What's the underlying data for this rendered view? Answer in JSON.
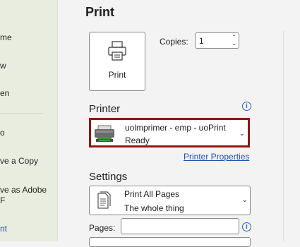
{
  "sidebar": {
    "items": [
      {
        "label": "me"
      },
      {
        "label": "w"
      },
      {
        "label": "en"
      },
      {
        "label": "o"
      },
      {
        "label": "ve a Copy"
      },
      {
        "label": "ve as Adobe"
      },
      {
        "label": "F"
      },
      {
        "label": "nt"
      }
    ]
  },
  "main": {
    "title": "Print",
    "print_button": {
      "label": "Print",
      "icon": "printer-icon"
    },
    "copies": {
      "label": "Copies:",
      "value": "1"
    },
    "printer": {
      "heading": "Printer",
      "name": "uolmprimer - emp - uoPrint",
      "status": "Ready",
      "properties_link": "Printer Properties"
    },
    "settings": {
      "heading": "Settings",
      "pages_option": "Print All Pages",
      "pages_option_desc": "The whole thing",
      "pages_label": "Pages:",
      "pages_value": ""
    }
  },
  "colors": {
    "sidebar_bg": "#e9eddf",
    "main_bg": "#f3f3f3",
    "highlight_border": "#8b1a10",
    "link": "#1f4fa8",
    "active_nav": "#2b4f9b"
  }
}
